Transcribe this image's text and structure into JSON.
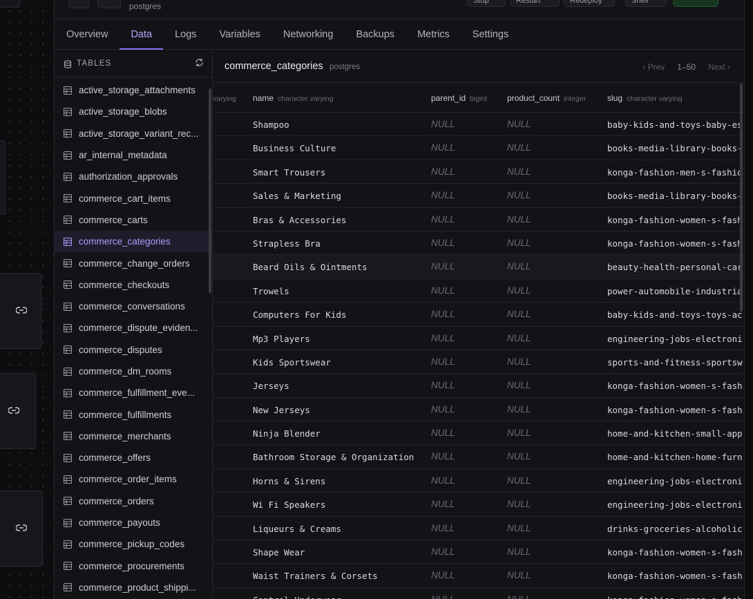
{
  "service": {
    "subtitle": "postgres"
  },
  "top_buttons": [
    "Stop",
    "Restart",
    "Redeploy",
    "Shell"
  ],
  "tabs": [
    {
      "label": "Overview"
    },
    {
      "label": "Data",
      "active": true
    },
    {
      "label": "Logs"
    },
    {
      "label": "Variables"
    },
    {
      "label": "Networking"
    },
    {
      "label": "Backups"
    },
    {
      "label": "Metrics"
    },
    {
      "label": "Settings"
    }
  ],
  "sidebar": {
    "title": "TABLES",
    "icon": "database-icon",
    "refresh_icon": "refresh-icon",
    "items": [
      "active_storage_attachments",
      "active_storage_blobs",
      "active_storage_variant_rec...",
      "ar_internal_metadata",
      "authorization_approvals",
      "commerce_cart_items",
      "commerce_carts",
      "commerce_categories",
      "commerce_change_orders",
      "commerce_checkouts",
      "commerce_conversations",
      "commerce_dispute_eviden...",
      "commerce_disputes",
      "commerce_dm_rooms",
      "commerce_fulfillment_eve...",
      "commerce_fulfillments",
      "commerce_merchants",
      "commerce_offers",
      "commerce_order_items",
      "commerce_orders",
      "commerce_payouts",
      "commerce_pickup_codes",
      "commerce_procurements",
      "commerce_product_shippi..."
    ],
    "active_item": "commerce_categories"
  },
  "table": {
    "name": "commerce_categories",
    "schema": "postgres",
    "pager": {
      "prev": "Prev",
      "range": "1–50",
      "next": "Next"
    },
    "columns": [
      {
        "name": "",
        "type": "varying"
      },
      {
        "name": "name",
        "type": "character varying"
      },
      {
        "name": "parent_id",
        "type": "bigint"
      },
      {
        "name": "product_count",
        "type": "integer"
      },
      {
        "name": "slug",
        "type": "character varying"
      }
    ],
    "rows": [
      {
        "name": "Shampoo",
        "parent_id": "NULL",
        "product_count": "NULL",
        "slug": "baby-kids-and-toys-baby-es"
      },
      {
        "name": "Business Culture",
        "parent_id": "NULL",
        "product_count": "NULL",
        "slug": "books-media-library-books-"
      },
      {
        "name": "Smart Trousers",
        "parent_id": "NULL",
        "product_count": "NULL",
        "slug": "konga-fashion-men-s-fashio"
      },
      {
        "name": "Sales & Marketing",
        "parent_id": "NULL",
        "product_count": "NULL",
        "slug": "books-media-library-books-"
      },
      {
        "name": "Bras & Accessories",
        "parent_id": "NULL",
        "product_count": "NULL",
        "slug": "konga-fashion-women-s-fash"
      },
      {
        "name": "Strapless Bra",
        "parent_id": "NULL",
        "product_count": "NULL",
        "slug": "konga-fashion-women-s-fash"
      },
      {
        "name": "Beard Oils & Ointments",
        "parent_id": "NULL",
        "product_count": "NULL",
        "slug": "beauty-health-personal-car"
      },
      {
        "name": "Trowels",
        "parent_id": "NULL",
        "product_count": "NULL",
        "slug": "power-automobile-industria"
      },
      {
        "name": "Computers For Kids",
        "parent_id": "NULL",
        "product_count": "NULL",
        "slug": "baby-kids-and-toys-toys-ac"
      },
      {
        "name": "Mp3 Players",
        "parent_id": "NULL",
        "product_count": "NULL",
        "slug": "engineering-jobs-electroni"
      },
      {
        "name": "Kids Sportswear",
        "parent_id": "NULL",
        "product_count": "NULL",
        "slug": "sports-and-fitness-sportsw"
      },
      {
        "name": "Jerseys",
        "parent_id": "NULL",
        "product_count": "NULL",
        "slug": "konga-fashion-women-s-fash"
      },
      {
        "name": "New Jerseys",
        "parent_id": "NULL",
        "product_count": "NULL",
        "slug": "konga-fashion-women-s-fash"
      },
      {
        "name": "Ninja Blender",
        "parent_id": "NULL",
        "product_count": "NULL",
        "slug": "home-and-kitchen-small-app"
      },
      {
        "name": "Bathroom Storage & Organization",
        "parent_id": "NULL",
        "product_count": "NULL",
        "slug": "home-and-kitchen-home-furn"
      },
      {
        "name": "Horns & Sirens",
        "parent_id": "NULL",
        "product_count": "NULL",
        "slug": "engineering-jobs-electroni"
      },
      {
        "name": "Wi Fi Speakers",
        "parent_id": "NULL",
        "product_count": "NULL",
        "slug": "engineering-jobs-electroni"
      },
      {
        "name": "Liqueurs & Creams",
        "parent_id": "NULL",
        "product_count": "NULL",
        "slug": "drinks-groceries-alcoholic"
      },
      {
        "name": "Shape Wear",
        "parent_id": "NULL",
        "product_count": "NULL",
        "slug": "konga-fashion-women-s-fash"
      },
      {
        "name": "Waist Trainers & Corsets",
        "parent_id": "NULL",
        "product_count": "NULL",
        "slug": "konga-fashion-women-s-fash"
      },
      {
        "name": "Control Underwear",
        "parent_id": "NULL",
        "product_count": "NULL",
        "slug": "konga-fashion-women-s-fash"
      }
    ]
  },
  "colors": {
    "accent": "#8b7cf6",
    "active_text": "#b09cff",
    "background": "#131317"
  }
}
